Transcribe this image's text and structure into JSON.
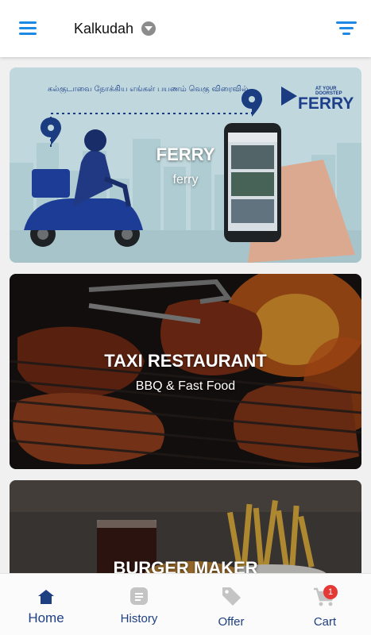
{
  "header": {
    "location": "Kalkudah",
    "menu_icon": "hamburger-icon",
    "dropdown_icon": "chevron-down-icon",
    "filter_icon": "filter-icon"
  },
  "cards": [
    {
      "title": "FERRY",
      "subtitle": "ferry",
      "banner_caption": "கல்குடாவை நோக்கிய எங்கள் பயணம் வெகு விரைவில்...",
      "brand_tagline": "AT YOUR DOORSTEP",
      "brand_name": "FERRY"
    },
    {
      "title": "TAXI RESTAURANT",
      "subtitle": "BBQ & Fast Food"
    },
    {
      "title": "BURGER MAKER"
    }
  ],
  "bottom_nav": {
    "items": [
      {
        "label": "Home",
        "icon": "home-icon"
      },
      {
        "label": "History",
        "icon": "history-icon"
      },
      {
        "label": "Offer",
        "icon": "tag-icon"
      },
      {
        "label": "Cart",
        "icon": "cart-icon",
        "badge": "1"
      }
    ]
  },
  "colors": {
    "accent": "#1e88e5",
    "nav_active": "#1f3f83",
    "nav_inactive": "#c4c4c4",
    "badge": "#e53935"
  }
}
